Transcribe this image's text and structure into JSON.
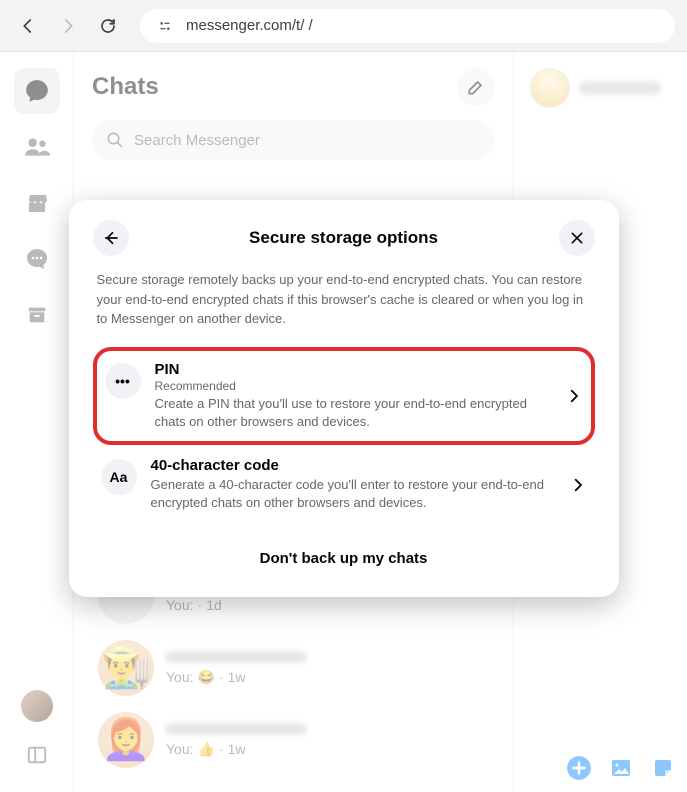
{
  "browser": {
    "url": "messenger.com/t/                              /"
  },
  "chats": {
    "title": "Chats",
    "search_placeholder": "Search Messenger"
  },
  "chat_items": [
    {
      "preview_prefix": "You:",
      "emoji": "",
      "time": "1d"
    },
    {
      "preview_prefix": "You:",
      "emoji": "😂",
      "time": "1w"
    },
    {
      "preview_prefix": "You:",
      "emoji": "👍",
      "time": "1w"
    }
  ],
  "modal": {
    "title": "Secure storage options",
    "description": "Secure storage remotely backs up your end-to-end encrypted chats. You can restore your end-to-end encrypted chats if this browser's cache is cleared or when you log in to Messenger on another device.",
    "option_pin": {
      "title": "PIN",
      "subtitle": "Recommended",
      "desc": "Create a PIN that you'll use to restore your end-to-end encrypted chats on other browsers and devices.",
      "icon_label": "•••"
    },
    "option_code": {
      "title": "40-character code",
      "desc": "Generate a 40-character code you'll enter to restore your end-to-end encrypted chats on other browsers and devices.",
      "icon_label": "Aa"
    },
    "no_backup": "Don't back up my chats"
  }
}
